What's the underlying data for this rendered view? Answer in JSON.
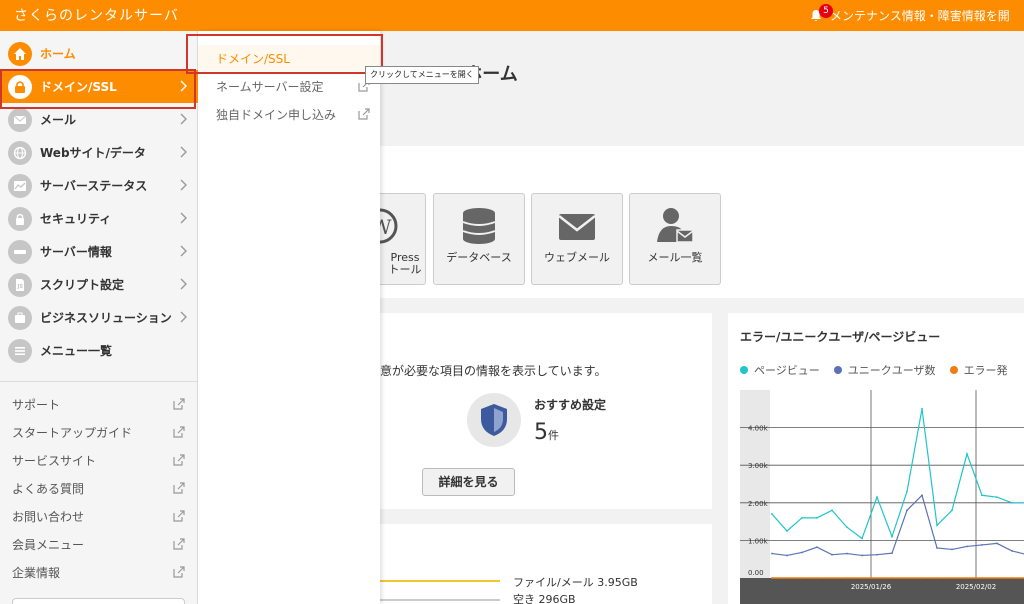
{
  "header": {
    "brand": "さくらのレンタルサーバ",
    "badge_count": "5",
    "notice": "メンテナンス情報・障害情報を開"
  },
  "sidebar": {
    "items": [
      {
        "label": "ホーム",
        "icon": "home-icon"
      },
      {
        "label": "ドメイン/SSL",
        "icon": "domain-icon"
      },
      {
        "label": "メール",
        "icon": "mail-icon"
      },
      {
        "label": "Webサイト/データ",
        "icon": "globe-icon"
      },
      {
        "label": "サーバーステータス",
        "icon": "chart-icon"
      },
      {
        "label": "セキュリティ",
        "icon": "lock-icon"
      },
      {
        "label": "サーバー情報",
        "icon": "server-icon"
      },
      {
        "label": "スクリプト設定",
        "icon": "script-icon"
      },
      {
        "label": "ビジネスソリューション",
        "icon": "briefcase-icon"
      },
      {
        "label": "メニュー一覧",
        "icon": "list-icon"
      }
    ],
    "links": [
      "サポート",
      "スタートアップガイド",
      "サービスサイト",
      "よくある質問",
      "お問い合わせ",
      "会員メニュー",
      "企業情報"
    ]
  },
  "flyout": {
    "items": [
      "ドメイン/SSL",
      "ネームサーバー設定",
      "独自ドメイン申し込み"
    ],
    "tooltip": "クリックしてメニューを開く"
  },
  "main": {
    "title": "ル ホーム",
    "apps": [
      {
        "line1": "Press",
        "line2": "トール",
        "icon": "wordpress-icon"
      },
      {
        "line1": "データベース",
        "line2": "",
        "icon": "database-icon"
      },
      {
        "line1": "ウェブメール",
        "line2": "",
        "icon": "envelope-icon"
      },
      {
        "line1": "メール一覧",
        "line2": "",
        "icon": "user-mail-icon"
      }
    ],
    "notice_text": "意が必要な項目の情報を表示しています。",
    "recommend_title": "おすすめ設定",
    "recommend_count": "5",
    "recommend_unit": "件",
    "detail_button": "詳細を見る",
    "disk_used": "ファイル/メール 3.95GB",
    "disk_free": "空き 296GB"
  },
  "chart_data": {
    "type": "line",
    "title": "エラー/ユニークユーザ/ページビュー",
    "series": [
      {
        "name": "ページビュー",
        "color": "#20c5c9",
        "values": [
          1700,
          1250,
          1600,
          1600,
          1800,
          1350,
          1050,
          2150,
          1100,
          2300,
          4500,
          1400,
          1800,
          3300,
          2200,
          2150,
          2000,
          2000
        ]
      },
      {
        "name": "ユニークユーザ数",
        "color": "#5b73b6",
        "values": [
          650,
          600,
          680,
          820,
          620,
          650,
          600,
          620,
          660,
          1800,
          2200,
          800,
          760,
          840,
          880,
          920,
          720,
          620
        ]
      },
      {
        "name": "エラー発",
        "color": "#f07d12",
        "values": [
          0,
          0,
          0,
          0,
          0,
          0,
          0,
          0,
          0,
          0,
          0,
          0,
          0,
          0,
          0,
          0,
          0,
          0
        ]
      }
    ],
    "yticks": [
      "4.00k",
      "3.00k",
      "2.00k",
      "1.00k",
      "0.00"
    ],
    "ylim": [
      0,
      5000
    ],
    "xtick_labels": [
      "2025/01/26",
      "2025/02/02"
    ],
    "grid": true,
    "legend": "top"
  }
}
